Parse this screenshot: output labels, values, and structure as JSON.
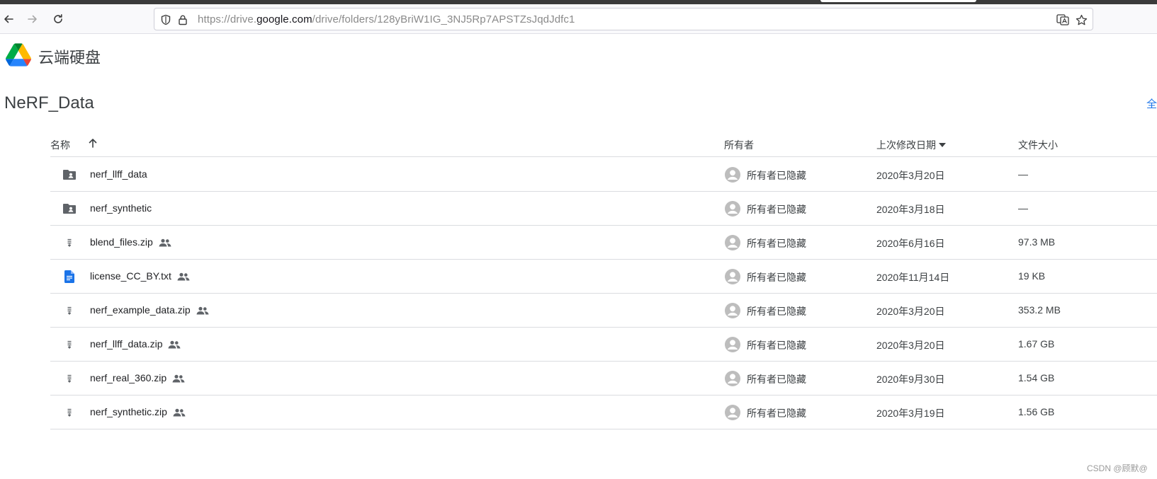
{
  "browser": {
    "url_prefix": "https://drive.",
    "url_host": "google.com",
    "url_path": "/drive/folders/128yBriW1IG_3NJ5Rp7APSTZsJqdJdfc1"
  },
  "app": {
    "brand": "云端硬盘",
    "folder_title": "NeRF_Data",
    "edge_link": "全"
  },
  "table": {
    "headers": {
      "name": "名称",
      "owner": "所有者",
      "modified": "上次修改日期",
      "size": "文件大小"
    },
    "rows": [
      {
        "name": "nerf_llff_data",
        "type": "shared-folder",
        "shared": false,
        "owner": "所有者已隐藏",
        "modified": "2020年3月20日",
        "size": "—"
      },
      {
        "name": "nerf_synthetic",
        "type": "shared-folder",
        "shared": false,
        "owner": "所有者已隐藏",
        "modified": "2020年3月18日",
        "size": "—"
      },
      {
        "name": "blend_files.zip",
        "type": "zip",
        "shared": true,
        "owner": "所有者已隐藏",
        "modified": "2020年6月16日",
        "size": "97.3 MB"
      },
      {
        "name": "license_CC_BY.txt",
        "type": "doc",
        "shared": true,
        "owner": "所有者已隐藏",
        "modified": "2020年11月14日",
        "size": "19 KB"
      },
      {
        "name": "nerf_example_data.zip",
        "type": "zip",
        "shared": true,
        "owner": "所有者已隐藏",
        "modified": "2020年3月20日",
        "size": "353.2 MB"
      },
      {
        "name": "nerf_llff_data.zip",
        "type": "zip",
        "shared": true,
        "owner": "所有者已隐藏",
        "modified": "2020年3月20日",
        "size": "1.67 GB"
      },
      {
        "name": "nerf_real_360.zip",
        "type": "zip",
        "shared": true,
        "owner": "所有者已隐藏",
        "modified": "2020年9月30日",
        "size": "1.54 GB"
      },
      {
        "name": "nerf_synthetic.zip",
        "type": "zip",
        "shared": true,
        "owner": "所有者已隐藏",
        "modified": "2020年3月19日",
        "size": "1.56 GB"
      }
    ]
  },
  "watermark": "CSDN @顾默@",
  "colors": {
    "folder_icon": "#5f6368",
    "doc_icon": "#1a73e8",
    "text": "#3c4043",
    "divider": "#dadce0"
  }
}
